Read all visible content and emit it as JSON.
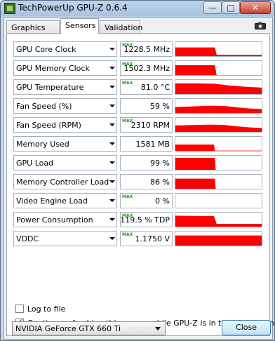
{
  "window": {
    "title": "TechPowerUp GPU-Z 0.6.4",
    "minimize_symbol": "—",
    "maximize_symbol": "□",
    "close_symbol": "✕"
  },
  "tabs": [
    {
      "label": "Graphics Card",
      "active": false
    },
    {
      "label": "Sensors",
      "active": true
    },
    {
      "label": "Validation",
      "active": false
    }
  ],
  "toolbar": {
    "camera_icon": "camera-icon"
  },
  "max_tag": "MAX",
  "sensors": [
    {
      "label": "GPU Core Clock",
      "value": "1228.5 MHz",
      "max": true,
      "graph": [
        [
          0,
          0.72
        ],
        [
          0.45,
          0.72
        ],
        [
          0.47,
          0.2
        ],
        [
          1,
          0.2
        ]
      ]
    },
    {
      "label": "GPU Memory Clock",
      "value": "1502.3 MHz",
      "max": true,
      "graph": [
        [
          0,
          0.8
        ],
        [
          0.45,
          0.8
        ],
        [
          0.47,
          0.1
        ],
        [
          1,
          0.1
        ]
      ]
    },
    {
      "label": "GPU Temperature",
      "value": "81.0 °C",
      "max": true,
      "graph": [
        [
          0,
          0.86
        ],
        [
          0.25,
          0.86
        ],
        [
          0.45,
          0.83
        ],
        [
          0.6,
          0.72
        ],
        [
          0.8,
          0.62
        ],
        [
          1,
          0.55
        ]
      ]
    },
    {
      "label": "Fan Speed (%)",
      "value": "59 %",
      "max": false,
      "graph": [
        [
          0,
          0.52
        ],
        [
          0.4,
          0.62
        ],
        [
          0.55,
          0.6
        ],
        [
          0.7,
          0.5
        ],
        [
          0.85,
          0.42
        ],
        [
          1,
          0.38
        ]
      ]
    },
    {
      "label": "Fan Speed (RPM)",
      "value": "2310 RPM",
      "max": true,
      "graph": [
        [
          0,
          0.56
        ],
        [
          0.4,
          0.62
        ],
        [
          0.55,
          0.6
        ],
        [
          0.7,
          0.5
        ],
        [
          0.85,
          0.42
        ],
        [
          1,
          0.38
        ]
      ]
    },
    {
      "label": "Memory Used",
      "value": "1581 MB",
      "max": false,
      "graph": [
        [
          0,
          0.55
        ],
        [
          0.44,
          0.55
        ],
        [
          0.45,
          0.12
        ],
        [
          1,
          0.12
        ]
      ]
    },
    {
      "label": "GPU Load",
      "value": "99 %",
      "max": false,
      "graph": [
        [
          0,
          0.95
        ],
        [
          0.45,
          0.95
        ],
        [
          0.46,
          0
        ],
        [
          1,
          0
        ]
      ]
    },
    {
      "label": "Memory Controller Load",
      "value": "86 %",
      "max": false,
      "graph": [
        [
          0,
          0.82
        ],
        [
          0.45,
          0.82
        ],
        [
          0.46,
          0
        ],
        [
          1,
          0
        ]
      ]
    },
    {
      "label": "Video Engine Load",
      "value": "0 %",
      "max": true,
      "graph": [
        [
          0,
          0
        ],
        [
          1,
          0
        ]
      ]
    },
    {
      "label": "Power Consumption",
      "value": "119.5 % TDP",
      "max": true,
      "graph": [
        [
          0,
          0.88
        ],
        [
          0.44,
          0.85
        ],
        [
          0.47,
          0.3
        ],
        [
          1,
          0.3
        ]
      ]
    },
    {
      "label": "VDDC",
      "value": "1.1750 V",
      "max": true,
      "graph": [
        [
          0,
          0.82
        ],
        [
          1,
          0.82
        ]
      ]
    }
  ],
  "options": {
    "log_to_file": {
      "label": "Log to file",
      "checked": false
    },
    "continue_refresh": {
      "label": "Continue refreshing this screen while GPU-Z is in the background",
      "checked": true
    }
  },
  "gpu_select": {
    "value": "NVIDIA GeForce GTX 660 Ti"
  },
  "close_button": {
    "label": "Close"
  },
  "colors": {
    "graph": "#ff0000",
    "max_tag": "#17a017"
  }
}
